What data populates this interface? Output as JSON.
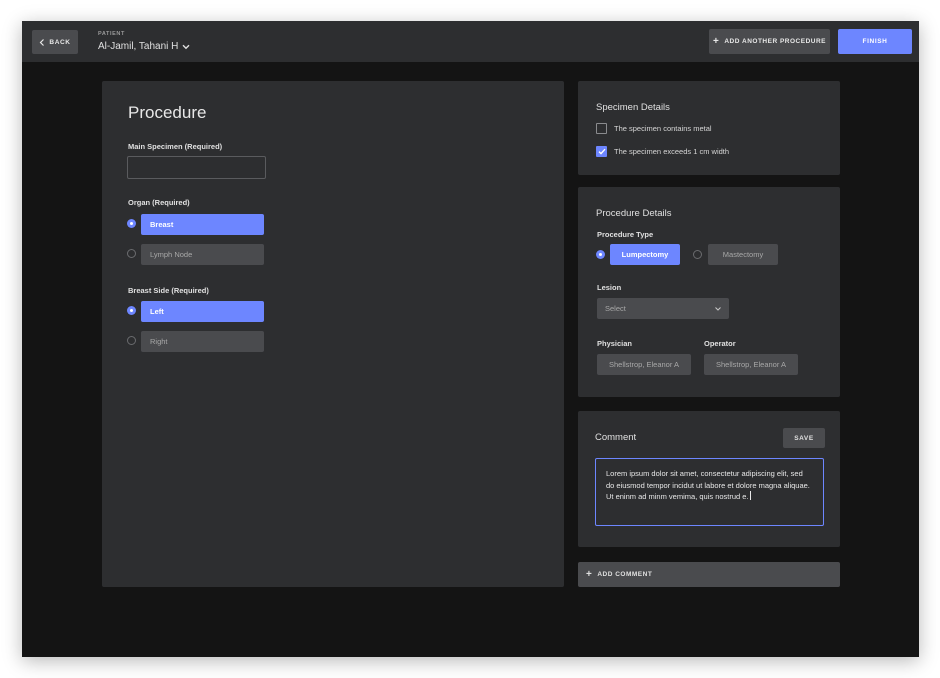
{
  "header": {
    "back_label": "BACK",
    "patient_caption": "PATIENT",
    "patient_name": "Al-Jamil, Tahani H",
    "add_procedure_label": "ADD ANOTHER PROCEDURE",
    "finish_label": "FINISH"
  },
  "procedure": {
    "title": "Procedure",
    "main_specimen_label": "Main Specimen (Required)",
    "main_specimen_value": "",
    "organ_label": "Organ (Required)",
    "organ_options": [
      {
        "label": "Breast",
        "selected": true
      },
      {
        "label": "Lymph Node",
        "selected": false
      }
    ],
    "breast_side_label": "Breast Side (Required)",
    "breast_side_options": [
      {
        "label": "Left",
        "selected": true
      },
      {
        "label": "Right",
        "selected": false
      }
    ]
  },
  "specimen_details": {
    "title": "Specimen Details",
    "checks": [
      {
        "label": "The specimen contains metal",
        "checked": false
      },
      {
        "label": "The specimen exceeds 1 cm width",
        "checked": true
      }
    ]
  },
  "procedure_details": {
    "title": "Procedure Details",
    "type_label": "Procedure Type",
    "type_options": [
      {
        "label": "Lumpectomy",
        "selected": true
      },
      {
        "label": "Mastectomy",
        "selected": false
      }
    ],
    "lesion_label": "Lesion",
    "lesion_value": "Select",
    "physician_label": "Physician",
    "physician_value": "Shellstrop, Eleanor A",
    "operator_label": "Operator",
    "operator_value": "Shellstrop, Eleanor A"
  },
  "comment": {
    "title": "Comment",
    "save_label": "SAVE",
    "text": "Lorem ipsum dolor sit amet, consectetur adipiscing elit, sed do eiusmod tempor incidut ut labore et dolore magna aliquae. Ut eninm ad minm vemima, quis nostrud e.",
    "add_comment_label": "ADD COMMENT"
  },
  "colors": {
    "accent": "#6d86ff",
    "panel": "#2d2e30",
    "background": "#141414"
  }
}
